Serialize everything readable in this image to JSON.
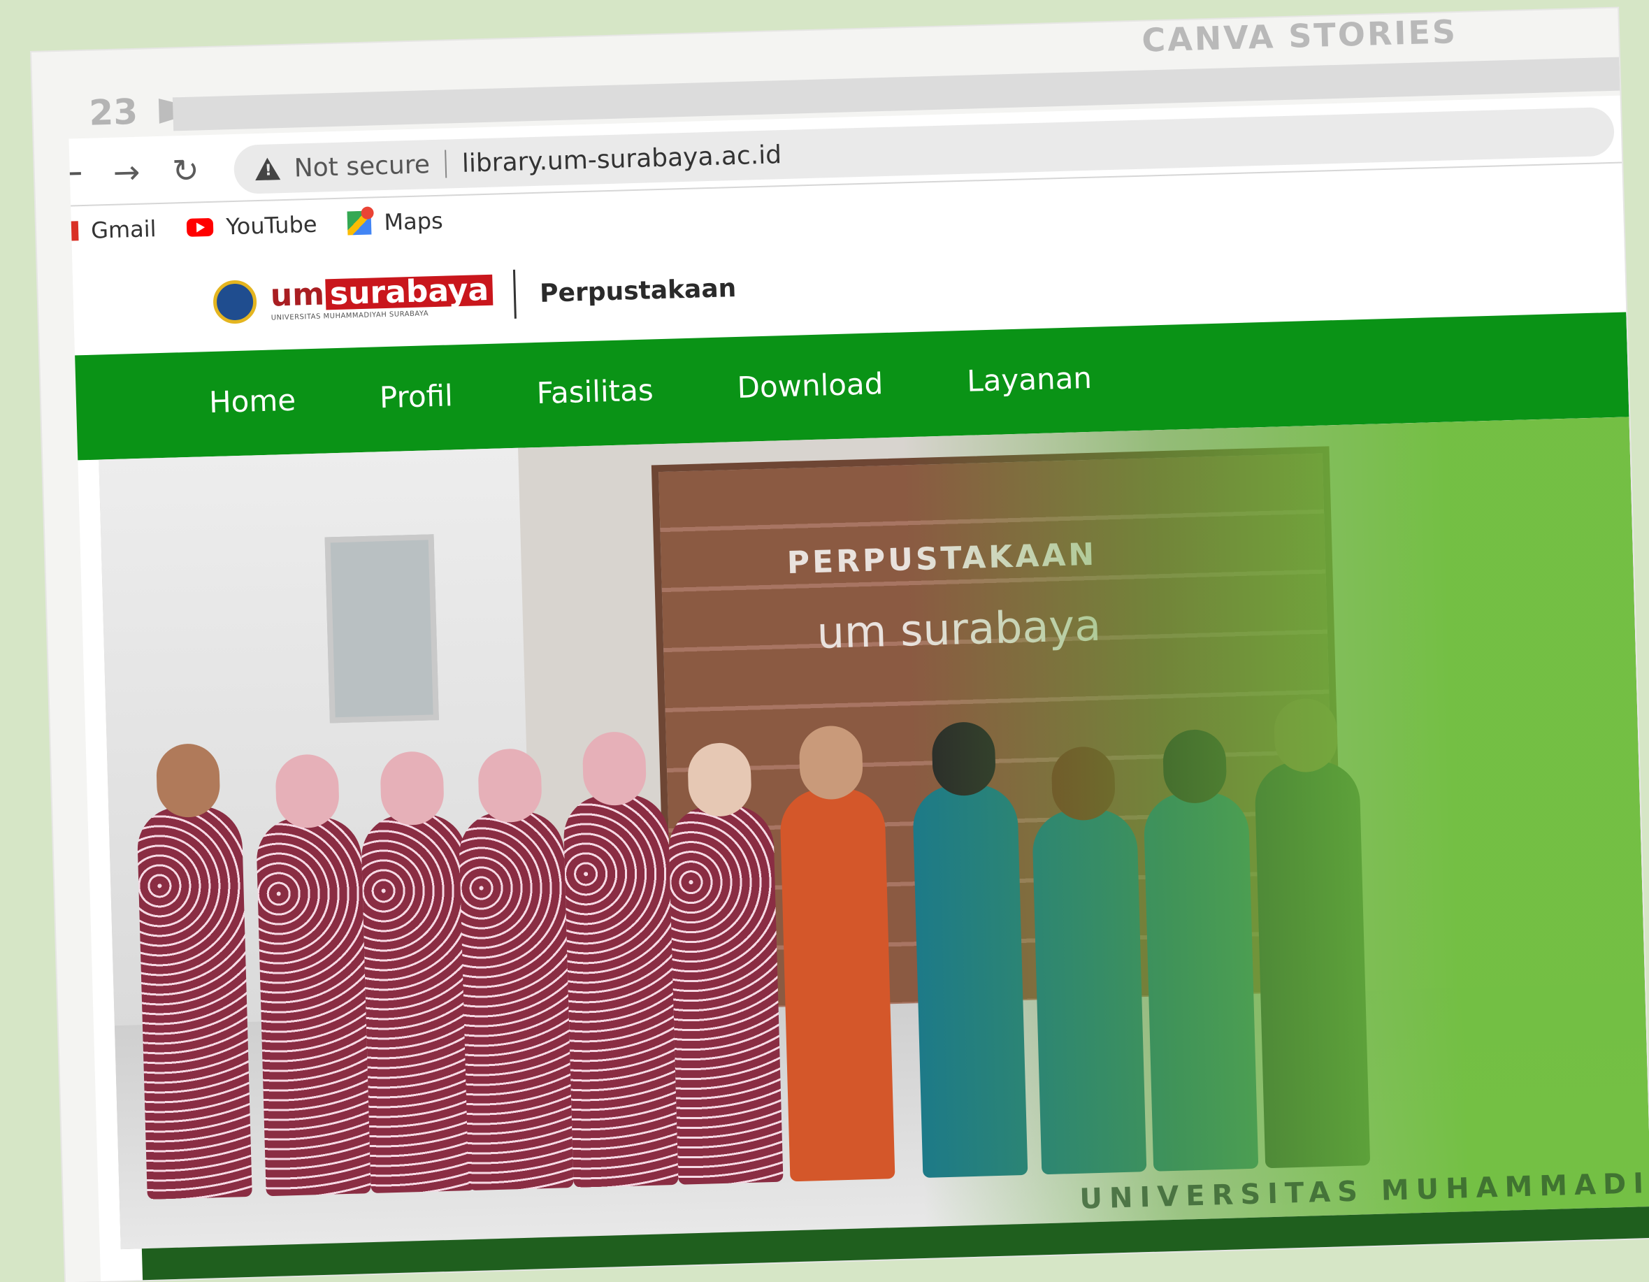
{
  "card": {
    "brand": "CANVA STORIES",
    "page_number": "23"
  },
  "browser": {
    "security_label": "Not secure",
    "url": "library.um-surabaya.ac.id",
    "bookmarks": [
      {
        "label": "Gmail",
        "icon": "gmail-icon"
      },
      {
        "label": "YouTube",
        "icon": "youtube-icon"
      },
      {
        "label": "Maps",
        "icon": "maps-icon"
      }
    ]
  },
  "site": {
    "logo_um": "um",
    "logo_surabaya": "surabaya",
    "logo_subtitle": "UNIVERSITAS MUHAMMADIYAH SURABAYA",
    "section_title": "Perpustakaan",
    "menu": [
      "Home",
      "Profil",
      "Fasilitas",
      "Download",
      "Layanan"
    ],
    "hero": {
      "sign_title": "PERPUSTAKAAN",
      "sign_subtitle": "um surabaya",
      "watermark": "UNIVERSITAS MUHAMMADI"
    }
  },
  "colors": {
    "nav_green": "#0a9316",
    "background": "#d6e6c6",
    "logo_red": "#c9161c"
  }
}
